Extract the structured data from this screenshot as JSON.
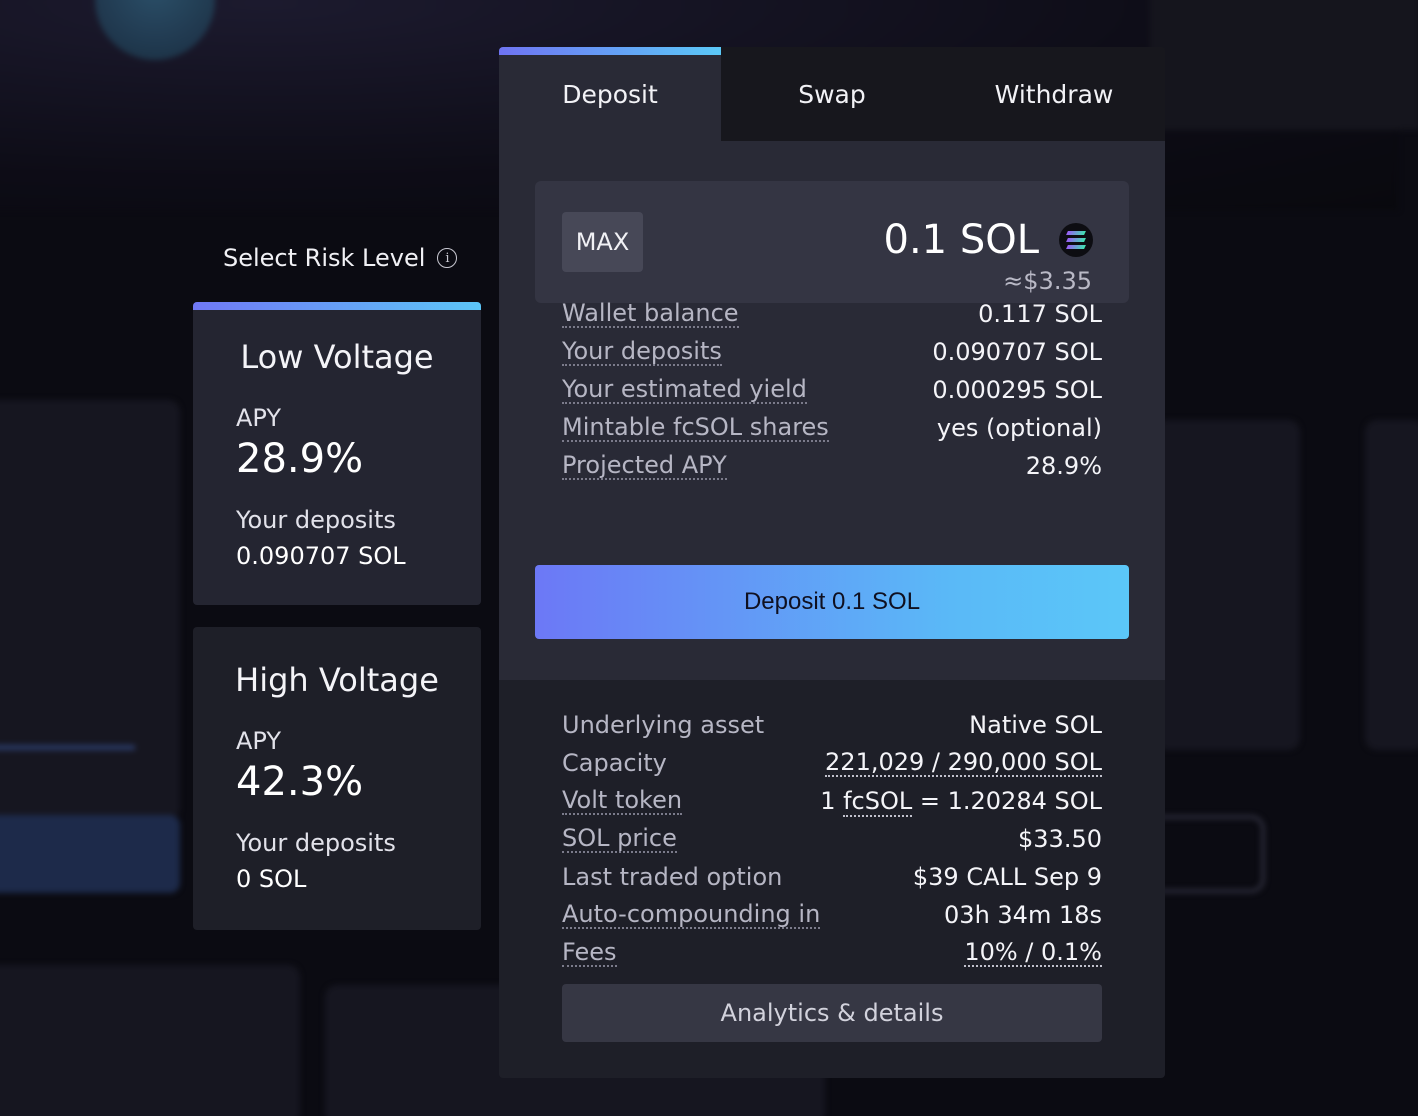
{
  "risk": {
    "title": "Select Risk Level",
    "info_glyph": "i",
    "cards": [
      {
        "name": "Low Voltage",
        "apy_label": "APY",
        "apy": "28.9%",
        "deposits_label": "Your deposits",
        "deposits": "0.090707 SOL"
      },
      {
        "name": "High Voltage",
        "apy_label": "APY",
        "apy": "42.3%",
        "deposits_label": "Your deposits",
        "deposits": "0 SOL"
      }
    ]
  },
  "tabs": [
    "Deposit",
    "Swap",
    "Withdraw"
  ],
  "amount": {
    "max_label": "MAX",
    "value": "0.1 SOL",
    "usd": "≈$3.35",
    "token_icon": "solana-icon"
  },
  "info": [
    {
      "label": "Wallet balance",
      "value": "0.117 SOL"
    },
    {
      "label": "Your deposits",
      "value": "0.090707 SOL"
    },
    {
      "label": "Your estimated yield",
      "value": "0.000295 SOL"
    },
    {
      "label": "Mintable fcSOL shares",
      "value": "yes (optional)"
    },
    {
      "label": "Projected APY",
      "value": "28.9%"
    }
  ],
  "deposit_button": "Deposit 0.1 SOL",
  "details": {
    "underlying_label": "Underlying asset",
    "underlying": "Native SOL",
    "capacity_label": "Capacity",
    "capacity": "221,029 / 290,000 SOL",
    "volt_label": "Volt token",
    "volt_prefix": "1 ",
    "volt_token": "fcSOL",
    "volt_suffix": " = 1.20284 SOL",
    "price_label": "SOL price",
    "price": "$33.50",
    "option_label": "Last traded option",
    "option": "$39 CALL Sep 9",
    "compound_label": "Auto-compounding in",
    "compound": "03h 34m 18s",
    "fees_label": "Fees",
    "fees": "10% / 0.1%"
  },
  "analytics_button": "Analytics & details",
  "colors": {
    "accent_start": "#6c78f6",
    "accent_end": "#5bc7f8",
    "panel": "#1e1f28",
    "panel_top": "#292a36"
  }
}
